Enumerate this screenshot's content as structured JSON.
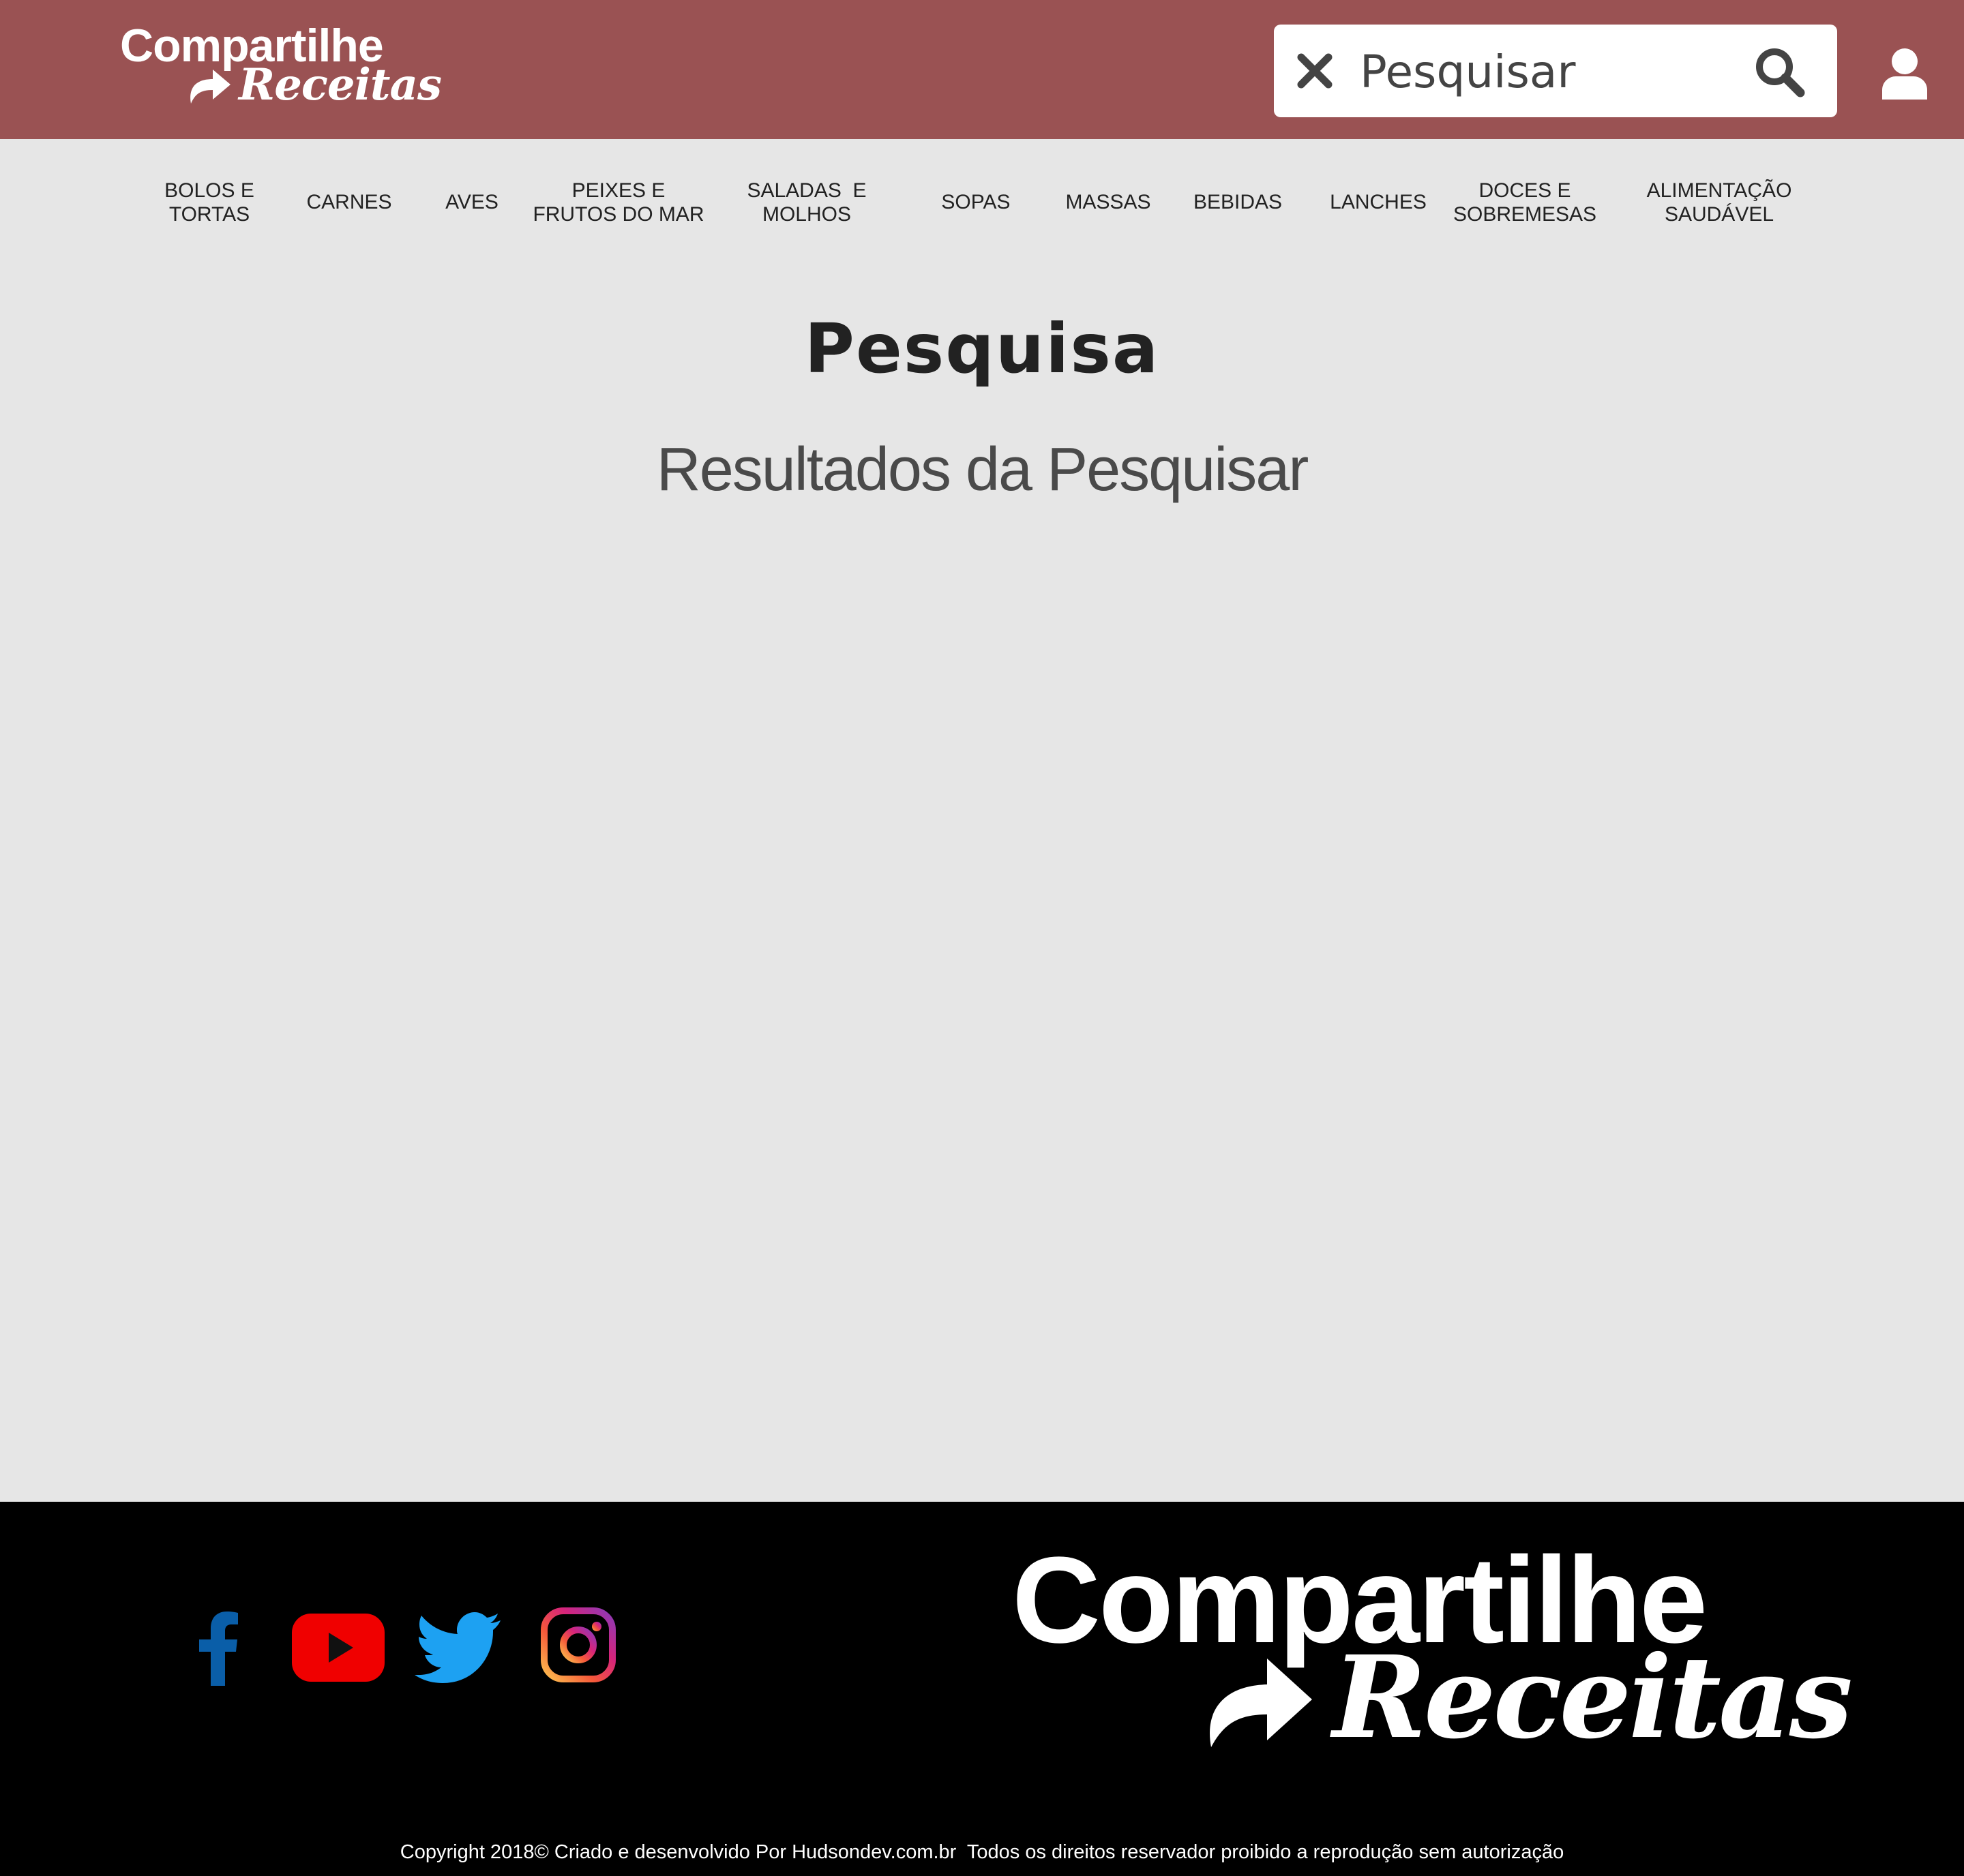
{
  "header": {
    "logo": {
      "line1": "Compartilhe",
      "line2": "Receitas"
    },
    "search": {
      "placeholder": "Pesquisar",
      "value": ""
    },
    "clear_icon": "close-icon",
    "search_icon": "search-icon",
    "user_icon": "user-icon"
  },
  "nav": {
    "items": [
      {
        "label": "Bolos e\nTortas"
      },
      {
        "label": "Carnes"
      },
      {
        "label": "Aves"
      },
      {
        "label": "Peixes e\nFrutos do Mar"
      },
      {
        "label": "Saladas  e\nMolhos"
      },
      {
        "label": "Sopas"
      },
      {
        "label": "Massas"
      },
      {
        "label": "Bebidas"
      },
      {
        "label": "Lanches"
      },
      {
        "label": "Doces e\nSobremesas"
      },
      {
        "label": "Alimentação\nSaudável"
      }
    ]
  },
  "main": {
    "title": "Pesquisa",
    "subtitle": "Resultados da Pesquisar"
  },
  "footer": {
    "social": [
      {
        "icon": "facebook-icon",
        "color": "#0a5ea8"
      },
      {
        "icon": "youtube-icon",
        "color": "#f00000"
      },
      {
        "icon": "twitter-icon",
        "color": "#1da1f2"
      },
      {
        "icon": "instagram-icon",
        "color": "#c13584"
      }
    ],
    "logo": {
      "line1": "Compartilhe",
      "line2": "Receitas"
    },
    "copyright": "Copyright 2018© Criado e desenvolvido Por Hudsondev.com.br  Todos os direitos reservador proibido a reprodução sem autorização"
  },
  "colors": {
    "header_bg": "#9a5253",
    "page_bg": "#e6e6e6",
    "footer_bg": "#000000"
  }
}
